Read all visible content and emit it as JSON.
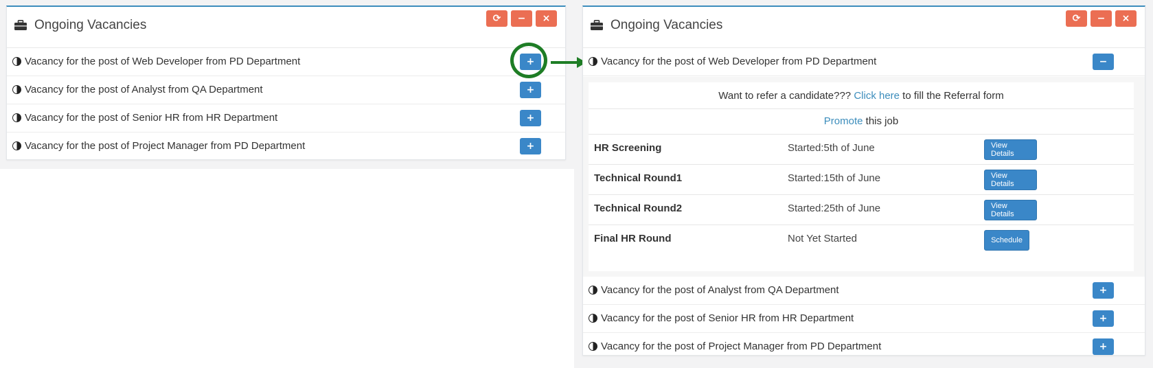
{
  "widget": {
    "title": "Ongoing Vacancies",
    "tools": {
      "refresh": "⟳",
      "collapse": "−",
      "close": "×"
    }
  },
  "vacancies": [
    {
      "label": "Vacancy for the post of Web Developer from PD Department"
    },
    {
      "label": "Vacancy for the post of Analyst from QA Department"
    },
    {
      "label": "Vacancy for the post of Senior HR from HR Department"
    },
    {
      "label": "Vacancy for the post of Project Manager from PD Department"
    }
  ],
  "expand_label": "+",
  "collapse_label": "−",
  "details": {
    "referral": {
      "before": "Want to refer a candidate??? ",
      "link": "Click here",
      "after": " to fill the Referral form"
    },
    "promote": {
      "link": "Promote",
      "after": " this job"
    },
    "stages": [
      {
        "name": "HR Screening",
        "status": "Started:5th of June",
        "button": "View Details"
      },
      {
        "name": "Technical Round1",
        "status": "Started:15th of June",
        "button": "View Details"
      },
      {
        "name": "Technical Round2",
        "status": "Started:25th of June",
        "button": "View Details"
      },
      {
        "name": "Final HR Round",
        "status": "Not Yet Started",
        "button": "Schedule"
      }
    ]
  },
  "colors": {
    "primary": "#3a87c8",
    "danger": "#eb6e53",
    "highlight": "#1e7d25",
    "link": "#3c8dbc"
  },
  "icons": {
    "header": "briefcase-icon",
    "row": "half-circle-icon",
    "annotation": "arrow-right-icon"
  }
}
